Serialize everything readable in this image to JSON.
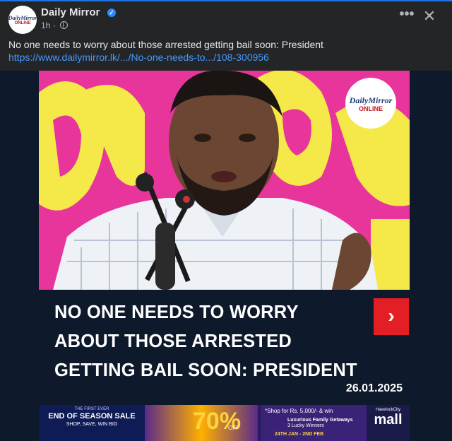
{
  "post": {
    "page_name": "Daily Mirror",
    "time": "1h",
    "dot": "·",
    "caption": "No one needs to worry about those arrested getting bail soon: President",
    "link": "https://www.dailymirror.lk/.../No-one-needs-to.../108-300956"
  },
  "avatar": {
    "brand_top": "DailyMirror",
    "brand_bottom": "ONLINE"
  },
  "actions": {
    "more": "•••",
    "close": "✕"
  },
  "media": {
    "watermark_top": "DailyMirror",
    "watermark_bottom": "ONLINE",
    "headline": "NO ONE NEEDS TO WORRY ABOUT THOSE ARRESTED GETTING BAIL SOON: PRESIDENT",
    "arrow": "›",
    "date": "26.01.2025"
  },
  "ad": {
    "kicker": "THE FIRST EVER",
    "sale_title": "END OF SEASON SALE",
    "sale_sub": "SHOP, SAVE, WIN BIG",
    "percent": "70%",
    "off": "OFF",
    "shop_line": "*Shop for Rs. 5,000/- & win",
    "prize_title": "Luxurious Family Getaways",
    "prize_sub": "3 Lucky Winners",
    "dates": "24TH JAN - 2ND FEB",
    "mall_top": "HavelockCity",
    "mall_name": "mall"
  },
  "colors": {
    "accent": "#2d88ff",
    "link": "#4599ff",
    "headline_bg": "#0e1a2b",
    "arrow_red": "#e31e24",
    "photo_pink": "#e8359b"
  }
}
